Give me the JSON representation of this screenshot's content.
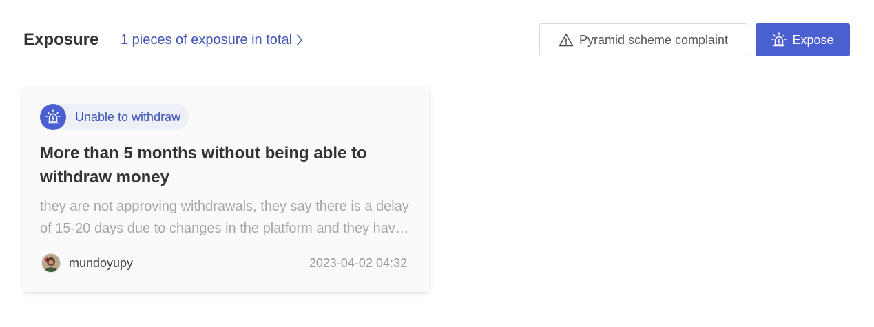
{
  "header": {
    "title": "Exposure",
    "total_link": "1 pieces of exposure in total",
    "complaint_button": "Pyramid scheme complaint",
    "expose_button": "Expose"
  },
  "colors": {
    "accent": "#4a5fd0",
    "link": "#4055b5",
    "tag_bg": "#eef0f7"
  },
  "icons": {
    "total_link": "chevron-right-icon",
    "complaint_button": "warning-icon",
    "expose_button": "alarm-icon",
    "tag": "alarm-icon"
  },
  "cards": [
    {
      "tag": "Unable to withdraw",
      "title": "More than 5 months without being able to withdraw money",
      "description": "they are not approving withdrawals, they say there is a delay of 15-20 days due to changes in the platform and they have not given any solution yet",
      "author": "mundoyupy",
      "timestamp": "2023-04-02 04:32"
    }
  ]
}
